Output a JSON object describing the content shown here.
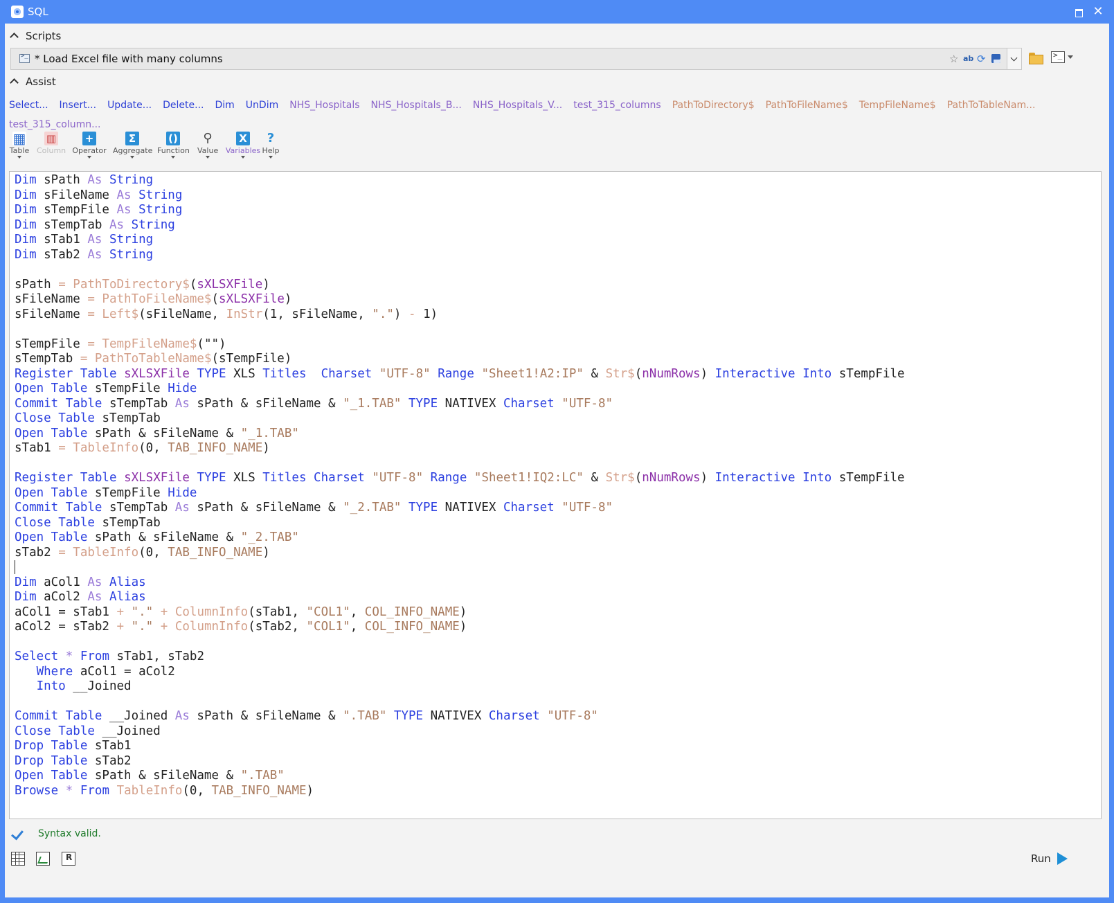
{
  "window": {
    "title": "SQL"
  },
  "scripts": {
    "section_label": "Scripts",
    "current_script": "* Load Excel file with many columns"
  },
  "assist": {
    "section_label": "Assist",
    "links": [
      {
        "label": "Select...",
        "kind": "blue"
      },
      {
        "label": "Insert...",
        "kind": "blue"
      },
      {
        "label": "Update...",
        "kind": "blue"
      },
      {
        "label": "Delete...",
        "kind": "blue"
      },
      {
        "label": "Dim",
        "kind": "blue"
      },
      {
        "label": "UnDim",
        "kind": "blue"
      },
      {
        "label": "NHS_Hospitals",
        "kind": "purple"
      },
      {
        "label": "NHS_Hospitals_B...",
        "kind": "purple"
      },
      {
        "label": "NHS_Hospitals_V...",
        "kind": "purple"
      },
      {
        "label": "test_315_columns",
        "kind": "purple"
      },
      {
        "label": "PathToDirectory$",
        "kind": "orange"
      },
      {
        "label": "PathToFileName$",
        "kind": "orange"
      },
      {
        "label": "TempFileName$",
        "kind": "orange"
      },
      {
        "label": "PathToTableNam...",
        "kind": "orange"
      },
      {
        "label": "test_315_column...",
        "kind": "purple"
      }
    ],
    "tools": [
      {
        "label": "Table",
        "icon": "table-icon"
      },
      {
        "label": "Column",
        "icon": "column-icon"
      },
      {
        "label": "Operator",
        "icon": "operator-icon"
      },
      {
        "label": "Aggregate",
        "icon": "sigma-icon"
      },
      {
        "label": "Function",
        "icon": "function-icon"
      },
      {
        "label": "Value",
        "icon": "magnifier-icon"
      },
      {
        "label": "Variables",
        "icon": "variables-icon"
      },
      {
        "label": "Help",
        "icon": "help-icon"
      }
    ]
  },
  "editor": {
    "lines": [
      [
        [
          "kw",
          "Dim"
        ],
        [
          "op",
          " sPath "
        ],
        [
          "as",
          "As"
        ],
        [
          "op",
          " "
        ],
        [
          "kw",
          "String"
        ]
      ],
      [
        [
          "kw",
          "Dim"
        ],
        [
          "op",
          " sFileName "
        ],
        [
          "as",
          "As"
        ],
        [
          "op",
          " "
        ],
        [
          "kw",
          "String"
        ]
      ],
      [
        [
          "kw",
          "Dim"
        ],
        [
          "op",
          " sTempFile "
        ],
        [
          "as",
          "As"
        ],
        [
          "op",
          " "
        ],
        [
          "kw",
          "String"
        ]
      ],
      [
        [
          "kw",
          "Dim"
        ],
        [
          "op",
          " sTempTab "
        ],
        [
          "as",
          "As"
        ],
        [
          "op",
          " "
        ],
        [
          "kw",
          "String"
        ]
      ],
      [
        [
          "kw",
          "Dim"
        ],
        [
          "op",
          " sTab1 "
        ],
        [
          "as",
          "As"
        ],
        [
          "op",
          " "
        ],
        [
          "kw",
          "String"
        ]
      ],
      [
        [
          "kw",
          "Dim"
        ],
        [
          "op",
          " sTab2 "
        ],
        [
          "as",
          "As"
        ],
        [
          "op",
          " "
        ],
        [
          "kw",
          "String"
        ]
      ],
      [],
      [
        [
          "op",
          "sPath "
        ],
        [
          "fn",
          "= PathToDirectory$"
        ],
        [
          "op",
          "("
        ],
        [
          "var",
          "sXLSXFile"
        ],
        [
          "op",
          ")"
        ]
      ],
      [
        [
          "op",
          "sFileName "
        ],
        [
          "fn",
          "= PathToFileName$"
        ],
        [
          "op",
          "("
        ],
        [
          "var",
          "sXLSXFile"
        ],
        [
          "op",
          ")"
        ]
      ],
      [
        [
          "op",
          "sFileName "
        ],
        [
          "fn",
          "= Left$"
        ],
        [
          "op",
          "(sFileName, "
        ],
        [
          "fn",
          "InStr"
        ],
        [
          "op",
          "(1, sFileName, "
        ],
        [
          "str",
          "\".\""
        ],
        [
          "op",
          ") "
        ],
        [
          "fn",
          "-"
        ],
        [
          "op",
          " 1)"
        ]
      ],
      [],
      [
        [
          "op",
          "sTempFile "
        ],
        [
          "fn",
          "= TempFileName$"
        ],
        [
          "op",
          "(\"\")"
        ]
      ],
      [
        [
          "op",
          "sTempTab "
        ],
        [
          "fn",
          "= PathToTableName$"
        ],
        [
          "op",
          "(sTempFile)"
        ]
      ],
      [
        [
          "kw",
          "Register Table"
        ],
        [
          "op",
          " "
        ],
        [
          "var",
          "sXLSXFile"
        ],
        [
          "op",
          " "
        ],
        [
          "kw",
          "TYPE"
        ],
        [
          "op",
          " XLS "
        ],
        [
          "kw",
          "Titles"
        ],
        [
          "op",
          "  "
        ],
        [
          "kw",
          "Charset"
        ],
        [
          "op",
          " "
        ],
        [
          "str",
          "\"UTF-8\""
        ],
        [
          "op",
          " "
        ],
        [
          "kw",
          "Range"
        ],
        [
          "op",
          " "
        ],
        [
          "str",
          "\"Sheet1!A2:IP\""
        ],
        [
          "op",
          " & "
        ],
        [
          "fn",
          "Str$"
        ],
        [
          "op",
          "("
        ],
        [
          "var",
          "nNumRows"
        ],
        [
          "op",
          ") "
        ],
        [
          "kw",
          "Interactive Into"
        ],
        [
          "op",
          " sTempFile"
        ]
      ],
      [
        [
          "kw",
          "Open Table"
        ],
        [
          "op",
          " sTempFile "
        ],
        [
          "kw",
          "Hide"
        ]
      ],
      [
        [
          "kw",
          "Commit Table"
        ],
        [
          "op",
          " sTempTab "
        ],
        [
          "as",
          "As"
        ],
        [
          "op",
          " sPath & sFileName & "
        ],
        [
          "str",
          "\"_1.TAB\""
        ],
        [
          "op",
          " "
        ],
        [
          "kw",
          "TYPE"
        ],
        [
          "op",
          " NATIVEX "
        ],
        [
          "kw",
          "Charset"
        ],
        [
          "op",
          " "
        ],
        [
          "str",
          "\"UTF-8\""
        ]
      ],
      [
        [
          "kw",
          "Close Table"
        ],
        [
          "op",
          " sTempTab"
        ]
      ],
      [
        [
          "kw",
          "Open Table"
        ],
        [
          "op",
          " sPath & sFileName & "
        ],
        [
          "str",
          "\"_1.TAB\""
        ]
      ],
      [
        [
          "op",
          "sTab1 "
        ],
        [
          "fn",
          "= TableInfo"
        ],
        [
          "op",
          "(0, "
        ],
        [
          "str",
          "TAB_INFO_NAME"
        ],
        [
          "op",
          ")"
        ]
      ],
      [],
      [
        [
          "kw",
          "Register Table"
        ],
        [
          "op",
          " "
        ],
        [
          "var",
          "sXLSXFile"
        ],
        [
          "op",
          " "
        ],
        [
          "kw",
          "TYPE"
        ],
        [
          "op",
          " XLS "
        ],
        [
          "kw",
          "Titles"
        ],
        [
          "op",
          " "
        ],
        [
          "kw",
          "Charset"
        ],
        [
          "op",
          " "
        ],
        [
          "str",
          "\"UTF-8\""
        ],
        [
          "op",
          " "
        ],
        [
          "kw",
          "Range"
        ],
        [
          "op",
          " "
        ],
        [
          "str",
          "\"Sheet1!IQ2:LC\""
        ],
        [
          "op",
          " & "
        ],
        [
          "fn",
          "Str$"
        ],
        [
          "op",
          "("
        ],
        [
          "var",
          "nNumRows"
        ],
        [
          "op",
          ") "
        ],
        [
          "kw",
          "Interactive Into"
        ],
        [
          "op",
          " sTempFile"
        ]
      ],
      [
        [
          "kw",
          "Open Table"
        ],
        [
          "op",
          " sTempFile "
        ],
        [
          "kw",
          "Hide"
        ]
      ],
      [
        [
          "kw",
          "Commit Table"
        ],
        [
          "op",
          " sTempTab "
        ],
        [
          "as",
          "As"
        ],
        [
          "op",
          " sPath & sFileName & "
        ],
        [
          "str",
          "\"_2.TAB\""
        ],
        [
          "op",
          " "
        ],
        [
          "kw",
          "TYPE"
        ],
        [
          "op",
          " NATIVEX "
        ],
        [
          "kw",
          "Charset"
        ],
        [
          "op",
          " "
        ],
        [
          "str",
          "\"UTF-8\""
        ]
      ],
      [
        [
          "kw",
          "Close Table"
        ],
        [
          "op",
          " sTempTab"
        ]
      ],
      [
        [
          "kw",
          "Open Table"
        ],
        [
          "op",
          " sPath & sFileName & "
        ],
        [
          "str",
          "\"_2.TAB\""
        ]
      ],
      [
        [
          "op",
          "sTab2 "
        ],
        [
          "fn",
          "= TableInfo"
        ],
        [
          "op",
          "(0, "
        ],
        [
          "str",
          "TAB_INFO_NAME"
        ],
        [
          "op",
          ")"
        ]
      ],
      [
        [
          "caret",
          ""
        ]
      ],
      [
        [
          "kw",
          "Dim"
        ],
        [
          "op",
          " aCol1 "
        ],
        [
          "as",
          "As"
        ],
        [
          "op",
          " "
        ],
        [
          "kw",
          "Alias"
        ]
      ],
      [
        [
          "kw",
          "Dim"
        ],
        [
          "op",
          " aCol2 "
        ],
        [
          "as",
          "As"
        ],
        [
          "op",
          " "
        ],
        [
          "kw",
          "Alias"
        ]
      ],
      [
        [
          "op",
          "aCol1 = sTab1 "
        ],
        [
          "fn",
          "+"
        ],
        [
          "op",
          " "
        ],
        [
          "str",
          "\".\""
        ],
        [
          "op",
          " "
        ],
        [
          "fn",
          "+ ColumnInfo"
        ],
        [
          "op",
          "(sTab1, "
        ],
        [
          "str",
          "\"COL1\""
        ],
        [
          "op",
          ", "
        ],
        [
          "str",
          "COL_INFO_NAME"
        ],
        [
          "op",
          ")"
        ]
      ],
      [
        [
          "op",
          "aCol2 = sTab2 "
        ],
        [
          "fn",
          "+"
        ],
        [
          "op",
          " "
        ],
        [
          "str",
          "\".\""
        ],
        [
          "op",
          " "
        ],
        [
          "fn",
          "+ ColumnInfo"
        ],
        [
          "op",
          "(sTab2, "
        ],
        [
          "str",
          "\"COL1\""
        ],
        [
          "op",
          ", "
        ],
        [
          "str",
          "COL_INFO_NAME"
        ],
        [
          "op",
          ")"
        ]
      ],
      [],
      [
        [
          "kw",
          "Select"
        ],
        [
          "op",
          " "
        ],
        [
          "as",
          "*"
        ],
        [
          "op",
          " "
        ],
        [
          "kw",
          "From"
        ],
        [
          "op",
          " sTab1, sTab2"
        ]
      ],
      [
        [
          "op",
          "   "
        ],
        [
          "kw",
          "Where"
        ],
        [
          "op",
          " aCol1 = aCol2"
        ]
      ],
      [
        [
          "op",
          "   "
        ],
        [
          "kw",
          "Into"
        ],
        [
          "op",
          " __Joined"
        ]
      ],
      [],
      [
        [
          "kw",
          "Commit Table"
        ],
        [
          "op",
          " __Joined "
        ],
        [
          "as",
          "As"
        ],
        [
          "op",
          " sPath & sFileName & "
        ],
        [
          "str",
          "\".TAB\""
        ],
        [
          "op",
          " "
        ],
        [
          "kw",
          "TYPE"
        ],
        [
          "op",
          " NATIVEX "
        ],
        [
          "kw",
          "Charset"
        ],
        [
          "op",
          " "
        ],
        [
          "str",
          "\"UTF-8\""
        ]
      ],
      [
        [
          "kw",
          "Close Table"
        ],
        [
          "op",
          " __Joined"
        ]
      ],
      [
        [
          "kw",
          "Drop Table"
        ],
        [
          "op",
          " sTab1"
        ]
      ],
      [
        [
          "kw",
          "Drop Table"
        ],
        [
          "op",
          " sTab2"
        ]
      ],
      [
        [
          "kw",
          "Open Table"
        ],
        [
          "op",
          " sPath & sFileName & "
        ],
        [
          "str",
          "\".TAB\""
        ]
      ],
      [
        [
          "kw",
          "Browse"
        ],
        [
          "op",
          " "
        ],
        [
          "as",
          "*"
        ],
        [
          "op",
          " "
        ],
        [
          "kw",
          "From"
        ],
        [
          "op",
          " "
        ],
        [
          "fn",
          "TableInfo"
        ],
        [
          "op",
          "(0, "
        ],
        [
          "str",
          "TAB_INFO_NAME"
        ],
        [
          "op",
          ")"
        ]
      ]
    ]
  },
  "status": {
    "message": "Syntax valid."
  },
  "run": {
    "label": "Run"
  }
}
